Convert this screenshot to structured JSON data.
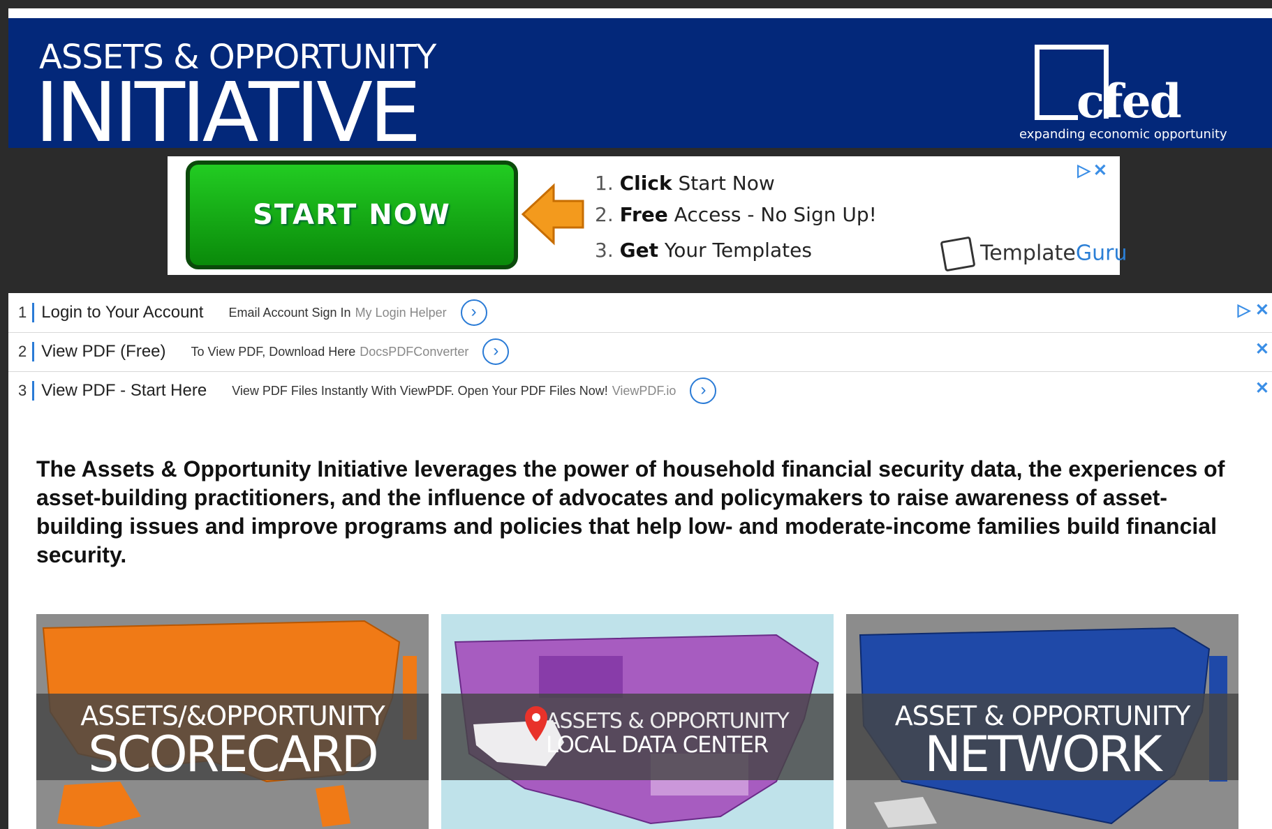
{
  "header": {
    "logo_top": "ASSETS & OPPORTUNITY",
    "logo_main": "INITIATIVE",
    "cfed_word": "cfed",
    "cfed_tagline": "expanding economic opportunity",
    "bg_color": "#03287a"
  },
  "banner_ad": {
    "button_label": "START NOW",
    "steps": [
      {
        "num": "1.",
        "bold": "Click",
        "rest": " Start Now"
      },
      {
        "num": "2.",
        "bold": "Free",
        "rest": " Access - No Sign Up!"
      },
      {
        "num": "3.",
        "bold": "Get",
        "rest": " Your Templates"
      }
    ],
    "brand_part1": "Template",
    "brand_part2": "Guru",
    "adchoices": "▷✕"
  },
  "text_ads": [
    {
      "num": "1",
      "title": "Login to Your Account",
      "desc": "Email Account Sign In",
      "source": "My Login Helper",
      "close": "▷ ✕"
    },
    {
      "num": "2",
      "title": "View PDF (Free)",
      "desc": "To View PDF, Download Here",
      "source": "DocsPDFConverter",
      "close": "✕"
    },
    {
      "num": "3",
      "title": "View PDF - Start Here",
      "desc": "View PDF Files Instantly With ViewPDF. Open Your PDF Files Now!",
      "source": "ViewPDF.io",
      "close": "✕"
    }
  ],
  "intro": "The Assets & Opportunity Initiative leverages the power of household financial security data, the experiences of asset-building practitioners, and the influence of advocates and policymakers to raise awareness of asset-building issues and improve programs and policies that help low- and moderate-income families build financial security.",
  "tiles": [
    {
      "line1": "ASSETS/&OPPORTUNITY",
      "line2": "SCORECARD"
    },
    {
      "line1": "ASSETS & OPPORTUNITY",
      "line2": "LOCAL DATA CENTER"
    },
    {
      "line1": "ASSET & OPPORTUNITY",
      "line2": "NETWORK"
    }
  ]
}
